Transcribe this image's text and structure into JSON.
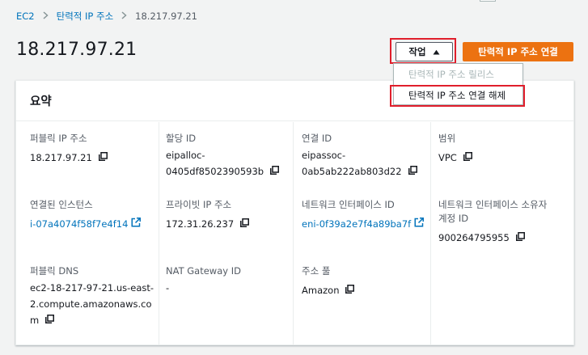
{
  "breadcrumb": {
    "items": [
      "EC2",
      "탄력적 IP 주소"
    ],
    "current": "18.217.97.21"
  },
  "page_title": "18.217.97.21",
  "header_actions": {
    "actions_label": "작업",
    "associate_label": "탄력적 IP 주소 연결"
  },
  "dropdown": {
    "release_label": "탄력적 IP 주소 릴리스",
    "disassociate_label": "탄력적 IP 주소 연결 해제"
  },
  "summary": {
    "title": "요약",
    "public_ip": {
      "label": "퍼블릭 IP 주소",
      "value": "18.217.97.21"
    },
    "alloc_id": {
      "label": "할당 ID",
      "value_l1": "eipalloc-",
      "value_l2": "0405df8502390593b"
    },
    "assoc_id": {
      "label": "연결 ID",
      "value_l1": "eipassoc-",
      "value_l2": "0ab5ab222ab803d22"
    },
    "scope": {
      "label": "범위",
      "value": "VPC"
    },
    "instance": {
      "label": "연결된 인스턴스",
      "value": "i-07a4074f58f7e4f14"
    },
    "private_ip": {
      "label": "프라이빗 IP 주소",
      "value": "172.31.26.237"
    },
    "eni": {
      "label": "네트워크 인터페이스 ID",
      "value": "eni-0f39a2e7f4a89ba7f"
    },
    "eni_owner": {
      "label_l1": "네트워크 인터페이스 소유자",
      "label_l2": "계정 ID",
      "value": "900264795955"
    },
    "public_dns": {
      "label": "퍼블릭 DNS",
      "value_l1": "ec2-18-217-97-21.us-east-",
      "value_l2": "2.compute.amazonaws.co",
      "value_l3": "m"
    },
    "nat_gateway": {
      "label": "NAT Gateway ID",
      "value": "-"
    },
    "pool": {
      "label": "주소 풀",
      "value": "Amazon"
    }
  },
  "icons": {
    "copy": "copy-icon",
    "external": "external-link-icon",
    "caret": "caret-up-icon"
  },
  "colors": {
    "accent_orange": "#ec7211",
    "link_blue": "#0073bb",
    "highlight_red": "#e01e2b"
  }
}
